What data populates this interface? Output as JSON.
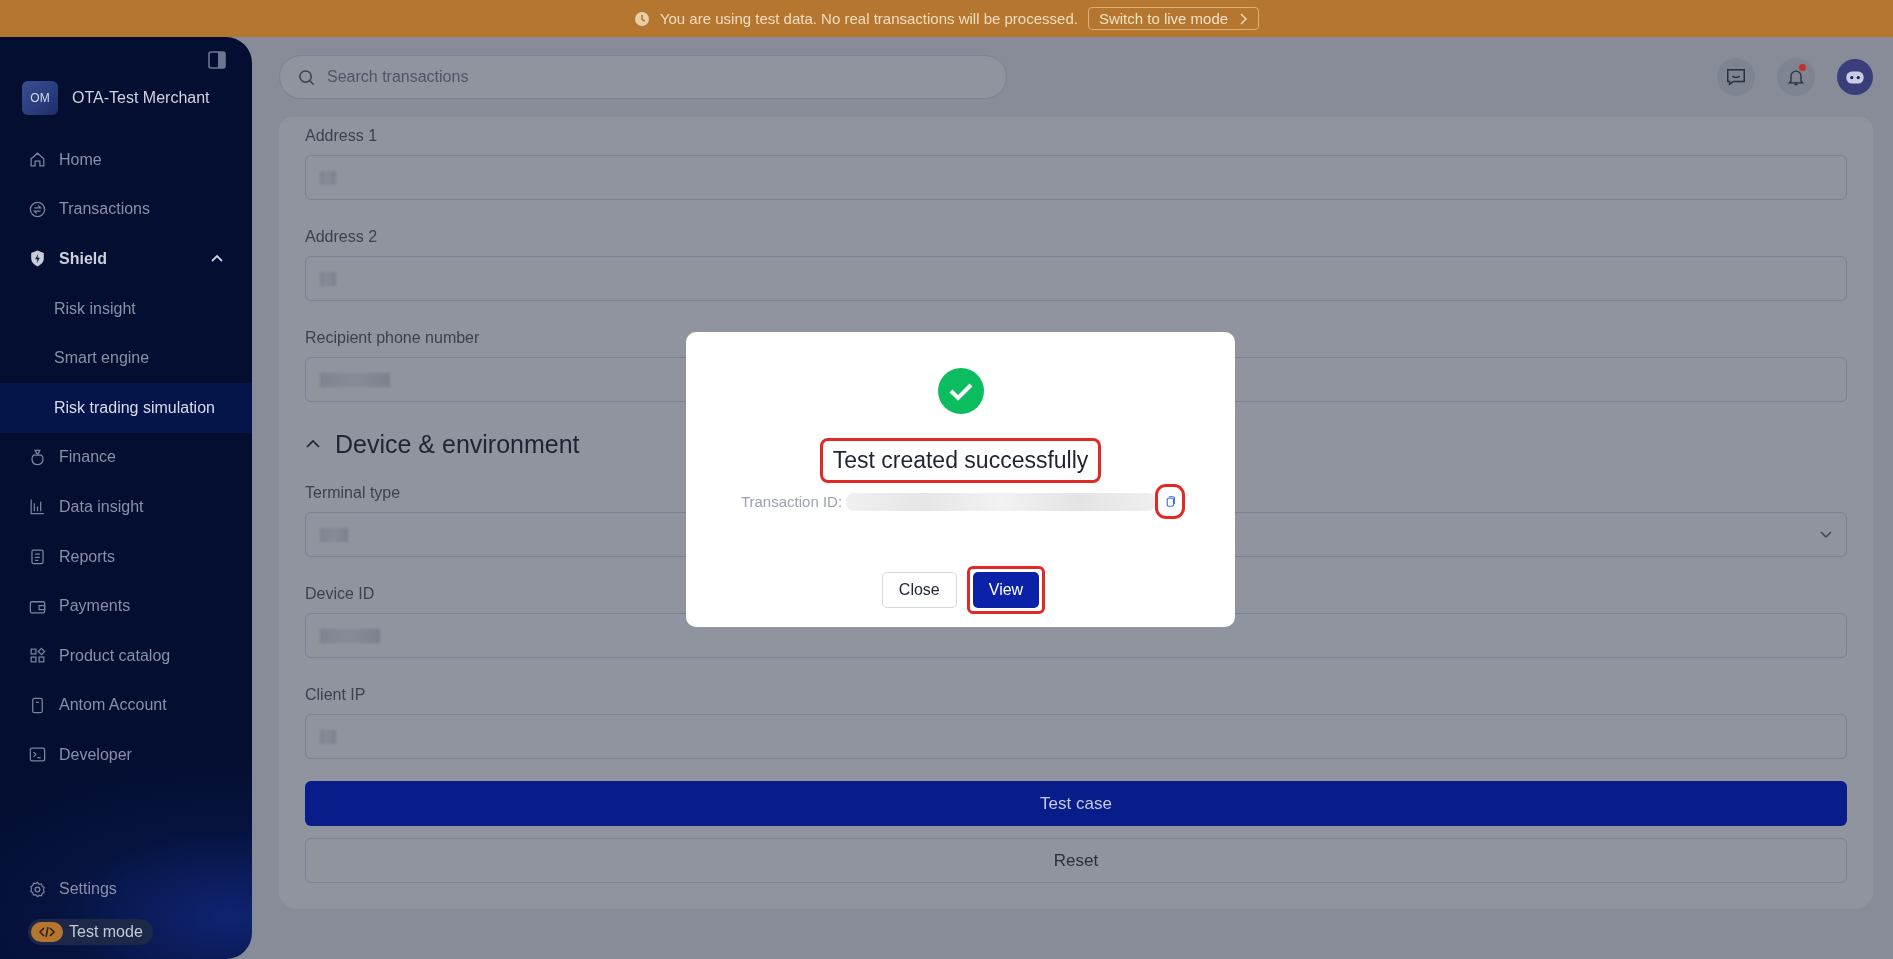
{
  "banner": {
    "message": "You are using test data. No real transactions will be processed.",
    "action": "Switch to live mode"
  },
  "sidebar": {
    "merchant_badge": "OM",
    "merchant_name": "OTA-Test Merchant",
    "items": [
      {
        "label": "Home",
        "selected": false
      },
      {
        "label": "Transactions",
        "selected": false
      },
      {
        "label": "Shield",
        "selected": false,
        "expanded": true,
        "children": [
          {
            "label": "Risk insight",
            "selected": false
          },
          {
            "label": "Smart engine",
            "selected": false
          },
          {
            "label": "Risk trading simulation",
            "selected": true
          }
        ]
      },
      {
        "label": "Finance",
        "selected": false
      },
      {
        "label": "Data insight",
        "selected": false
      },
      {
        "label": "Reports",
        "selected": false
      },
      {
        "label": "Payments",
        "selected": false
      },
      {
        "label": "Product catalog",
        "selected": false
      },
      {
        "label": "Antom Account",
        "selected": false
      },
      {
        "label": "Developer",
        "selected": false
      }
    ],
    "settings": "Settings",
    "mode_badge": "Test mode"
  },
  "search": {
    "placeholder": "Search transactions"
  },
  "notifications": {
    "unread": true
  },
  "form": {
    "items": [
      {
        "kind": "input",
        "label": "Address 1",
        "redacted": true
      },
      {
        "kind": "input",
        "label": "Address 2",
        "redacted": true
      },
      {
        "kind": "input",
        "label": "Recipient phone number",
        "redacted": true
      },
      {
        "kind": "section",
        "title": "Device & environment",
        "expanded": true
      },
      {
        "kind": "select",
        "label": "Terminal type",
        "redacted": true
      },
      {
        "kind": "input",
        "label": "Device ID",
        "redacted": true
      },
      {
        "kind": "input",
        "label": "Client IP",
        "redacted": true
      }
    ],
    "buttons": [
      {
        "label": "Test case",
        "kind": "primary"
      },
      {
        "label": "Reset",
        "kind": "default"
      }
    ]
  },
  "dialog": {
    "title": "Test created successfully",
    "title_highlighted": true,
    "id_label": "Transaction ID:",
    "id_redacted": true,
    "copy_highlighted": true,
    "buttons": [
      {
        "label": "Close",
        "kind": "default",
        "highlighted": false
      },
      {
        "label": "View",
        "kind": "primary",
        "highlighted": true
      }
    ]
  }
}
